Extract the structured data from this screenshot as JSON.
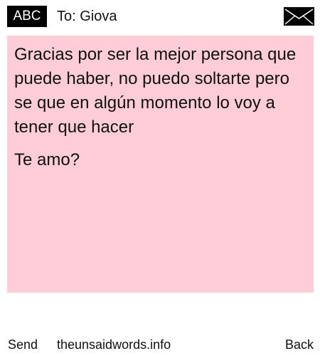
{
  "header": {
    "badge_label": "ABC",
    "recipient_label": "To: Giova",
    "envelope_icon": "envelope-icon"
  },
  "message": {
    "paragraphs": [
      "Gracias por ser la mejor persona que puede haber, no puedo soltarte pero se que en algún momento lo voy a tener que hacer",
      "Te amo?"
    ],
    "background_color": "#ffcdd7"
  },
  "footer": {
    "send_label": "Send",
    "site_label": "theunsaidwords.info",
    "back_label": "Back"
  }
}
